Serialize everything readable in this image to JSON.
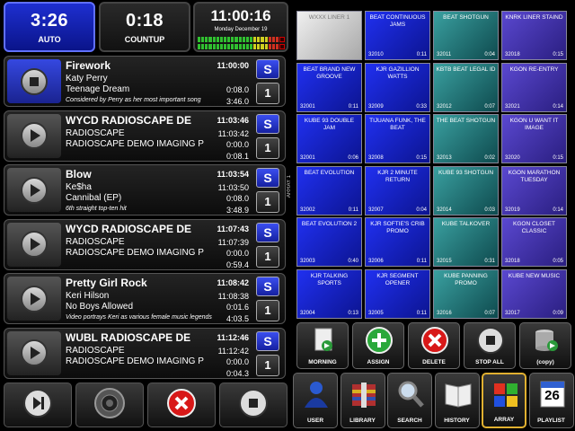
{
  "counters": {
    "auto": {
      "time": "3:26",
      "label": "AUTO"
    },
    "countup": {
      "time": "0:18",
      "label": "COUNTUP"
    },
    "clock": {
      "time": "11:00:16",
      "date": "Monday December 19"
    }
  },
  "playlist": [
    {
      "title": "Firework",
      "artist": "Katy Perry",
      "album": "Teenage Dream",
      "note": "Considered by Perry as her most important song",
      "start": "11:00:00",
      "end": "",
      "intro": "0:08.0",
      "duration": "3:46.0",
      "s": "S",
      "n": "1",
      "state": "stop",
      "active": true
    },
    {
      "title": "WYCD RADIOSCAPE DE",
      "artist": "RADIOSCAPE",
      "album": "RADIOSCAPE DEMO IMAGING P",
      "note": "",
      "start": "11:03:46",
      "end": "11:03:42",
      "intro": "0:00.0",
      "duration": "0:08.1",
      "s": "S",
      "n": "1",
      "state": "play",
      "active": false
    },
    {
      "title": "Blow",
      "artist": "Ke$ha",
      "album": "Cannibal (EP)",
      "note": "6th straight top-ten hit",
      "start": "11:03:54",
      "end": "11:03:50",
      "intro": "0:08.0",
      "duration": "3:48.9",
      "s": "S",
      "n": "1",
      "state": "play",
      "active": false
    },
    {
      "title": "WYCD RADIOSCAPE DE",
      "artist": "RADIOSCAPE",
      "album": "RADIOSCAPE DEMO IMAGING P",
      "note": "",
      "start": "11:07:43",
      "end": "11:07:39",
      "intro": "0:00.0",
      "duration": "0:59.4",
      "s": "S",
      "n": "1",
      "state": "play",
      "active": false
    },
    {
      "title": "Pretty Girl Rock",
      "artist": "Keri Hilson",
      "album": "No Boys Allowed",
      "note": "Video portrays Keri as various female music legends",
      "start": "11:08:42",
      "end": "11:08:38",
      "intro": "0:01.6",
      "duration": "4:03.5",
      "s": "S",
      "n": "1",
      "state": "play",
      "active": false
    },
    {
      "title": "WUBL RADIOSCAPE DE",
      "artist": "RADIOSCAPE",
      "album": "RADIOSCAPE DEMO IMAGING P",
      "note": "",
      "start": "11:12:46",
      "end": "11:12:42",
      "intro": "0:00.0",
      "duration": "0:04.3",
      "s": "S",
      "n": "1",
      "state": "play",
      "active": false
    }
  ],
  "controls": [
    {
      "name": "next-icon",
      "color": "#e8e8e8"
    },
    {
      "name": "speaker-icon",
      "color": "#888888"
    },
    {
      "name": "delete-icon",
      "color": "#d81818"
    },
    {
      "name": "stop-icon",
      "color": "#e8e8e8"
    }
  ],
  "array_label": "ARRAY 1",
  "carts": [
    {
      "label": "WXXX LINER 1",
      "num": "",
      "dur": "",
      "style": "white"
    },
    {
      "label": "BEAT CONTINUOUS JAMS",
      "num": "32010",
      "dur": "0:11",
      "style": "blue"
    },
    {
      "label": "BEAT SHOTGUN",
      "num": "32011",
      "dur": "0:04",
      "style": "teal"
    },
    {
      "label": "KNRK LINER STAIND",
      "num": "32018",
      "dur": "0:15",
      "style": "purple"
    },
    {
      "label": "BEAT BRAND NEW GROOVE",
      "num": "32001",
      "dur": "0:11",
      "style": "blue"
    },
    {
      "label": "KJR GAZILLION WATTS",
      "num": "32009",
      "dur": "0:33",
      "style": "blue"
    },
    {
      "label": "KBTB BEAT LEGAL ID",
      "num": "32012",
      "dur": "0:07",
      "style": "teal"
    },
    {
      "label": "KGON RE-ENTRY",
      "num": "32021",
      "dur": "0:14",
      "style": "purple"
    },
    {
      "label": "KUBE 93 DOUBLE JAM",
      "num": "32001",
      "dur": "0:06",
      "style": "blue"
    },
    {
      "label": "TIJUANA FUNK, THE BEAT",
      "num": "32008",
      "dur": "0:15",
      "style": "blue"
    },
    {
      "label": "THE BEAT SHOTGUN",
      "num": "32013",
      "dur": "0:02",
      "style": "teal"
    },
    {
      "label": "KGON U WANT IT IMAGE",
      "num": "32020",
      "dur": "0:15",
      "style": "purple"
    },
    {
      "label": "BEAT EVOLUTION",
      "num": "32002",
      "dur": "0:11",
      "style": "blue"
    },
    {
      "label": "KJR 2 MINUTE RETURN",
      "num": "32007",
      "dur": "0:04",
      "style": "blue"
    },
    {
      "label": "KUBE 93 SHOTGUN",
      "num": "32014",
      "dur": "0:03",
      "style": "teal"
    },
    {
      "label": "KGON MARATHON TUESDAY",
      "num": "32019",
      "dur": "0:14",
      "style": "purple"
    },
    {
      "label": "BEAT EVOLUTION 2",
      "num": "32003",
      "dur": "0:40",
      "style": "blue"
    },
    {
      "label": "KJR SOFTIE'S CRIB PROMO",
      "num": "32006",
      "dur": "0:11",
      "style": "blue"
    },
    {
      "label": "KUBE TALKOVER",
      "num": "32015",
      "dur": "0:31",
      "style": "teal"
    },
    {
      "label": "KGON CLOSET CLASSIC",
      "num": "32018",
      "dur": "0:05",
      "style": "purple"
    },
    {
      "label": "KJR TALKING SPORTS",
      "num": "32004",
      "dur": "0:13",
      "style": "blue"
    },
    {
      "label": "KJR SEGMENT OPENER",
      "num": "32005",
      "dur": "0:11",
      "style": "blue"
    },
    {
      "label": "KUBE PANNING PROMO",
      "num": "32016",
      "dur": "0:07",
      "style": "teal"
    },
    {
      "label": "KUBE NEW MUSIC",
      "num": "32017",
      "dur": "0:09",
      "style": "purple"
    }
  ],
  "actions": [
    {
      "label": "MORNING",
      "icon": "document-arrow-icon"
    },
    {
      "label": "ASSIGN",
      "icon": "add-icon"
    },
    {
      "label": "DELETE",
      "icon": "delete-icon"
    },
    {
      "label": "STOP ALL",
      "icon": "stop-all-icon"
    },
    {
      "label": "(copy)",
      "icon": "copy-database-icon"
    }
  ],
  "nav": [
    {
      "label": "USER",
      "icon": "user-icon",
      "selected": false
    },
    {
      "label": "LIBRARY",
      "icon": "library-icon",
      "selected": false
    },
    {
      "label": "SEARCH",
      "icon": "search-icon",
      "selected": false
    },
    {
      "label": "HISTORY",
      "icon": "history-book-icon",
      "selected": false
    },
    {
      "label": "ARRAY",
      "icon": "array-grid-icon",
      "selected": true
    },
    {
      "label": "PLAYLIST",
      "icon": "calendar-icon",
      "selected": false,
      "badge": "26"
    }
  ],
  "colors": {
    "accent_blue": "#1e2fd0",
    "selected_border": "#e0b030",
    "delete_red": "#d81818"
  }
}
